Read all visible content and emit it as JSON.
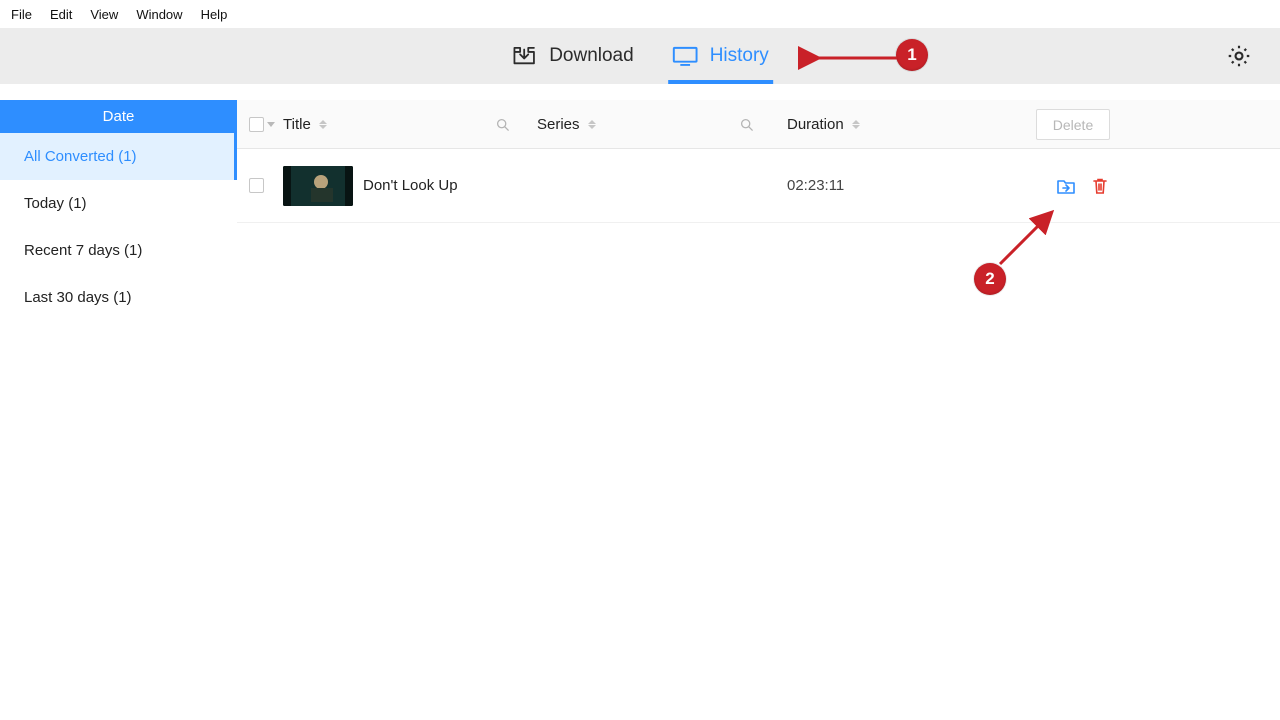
{
  "menu": {
    "items": [
      "File",
      "Edit",
      "View",
      "Window",
      "Help"
    ]
  },
  "toolbar": {
    "tabs": [
      {
        "id": "download",
        "label": "Download",
        "active": false
      },
      {
        "id": "history",
        "label": "History",
        "active": true
      }
    ]
  },
  "sidebar": {
    "heading": "Date",
    "filters": [
      {
        "label": "All Converted (1)",
        "active": true
      },
      {
        "label": "Today (1)",
        "active": false
      },
      {
        "label": "Recent 7 days (1)",
        "active": false
      },
      {
        "label": "Last 30 days (1)",
        "active": false
      }
    ]
  },
  "table": {
    "columns": {
      "title": "Title",
      "series": "Series",
      "duration": "Duration"
    },
    "delete_label": "Delete",
    "rows": [
      {
        "title": "Don't Look Up",
        "series": "",
        "duration": "02:23:11"
      }
    ]
  },
  "annotations": {
    "badge1": "1",
    "badge2": "2"
  }
}
